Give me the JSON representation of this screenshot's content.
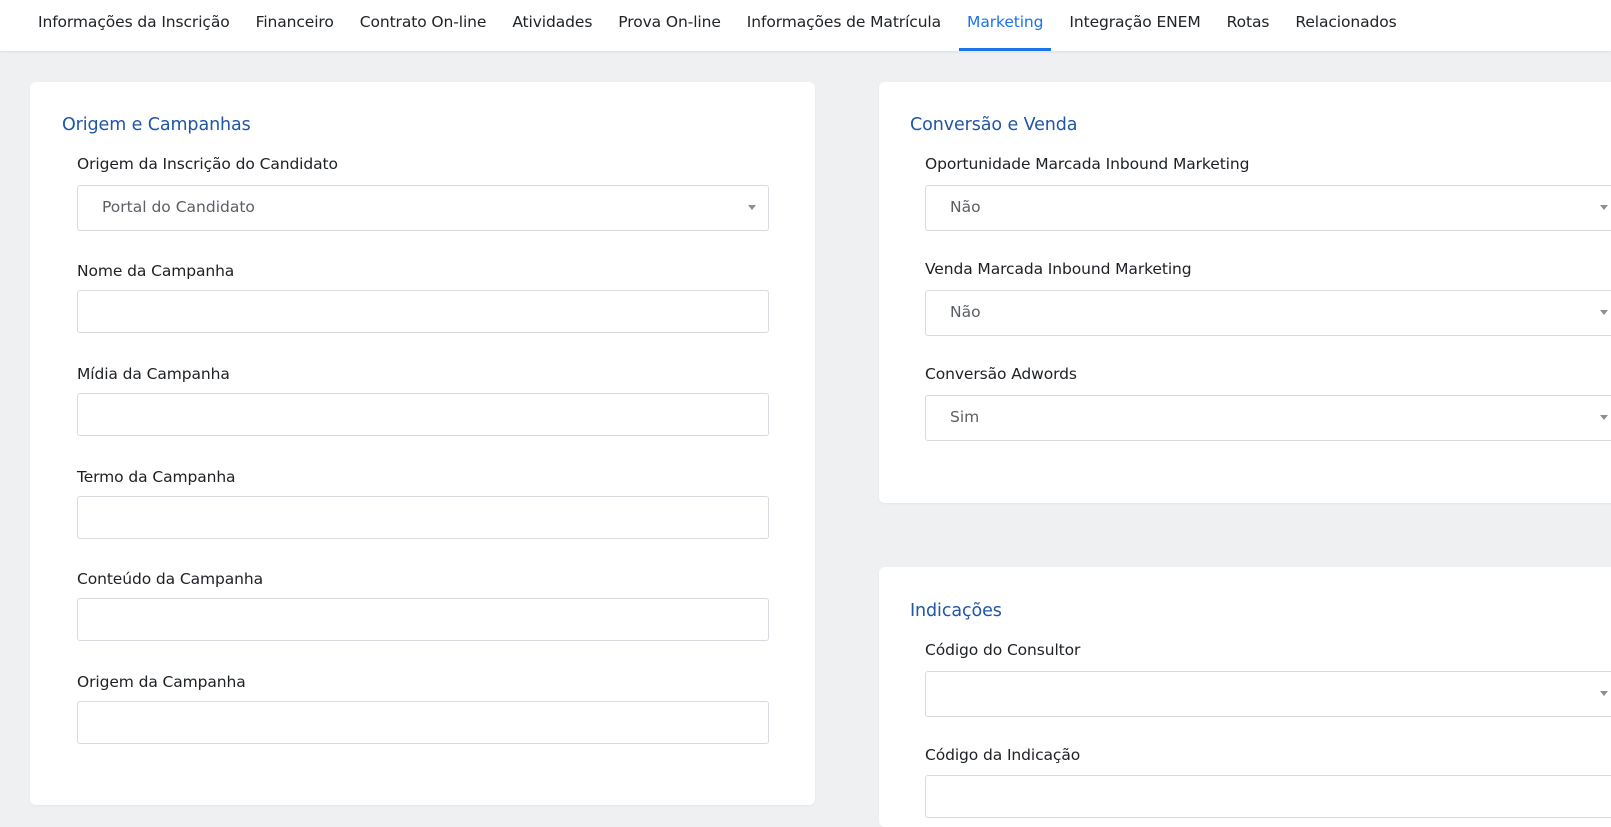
{
  "tabs": [
    {
      "label": "Informações da Inscrição",
      "active": false
    },
    {
      "label": "Financeiro",
      "active": false
    },
    {
      "label": "Contrato On-line",
      "active": false
    },
    {
      "label": "Atividades",
      "active": false
    },
    {
      "label": "Prova On-line",
      "active": false
    },
    {
      "label": "Informações de Matrícula",
      "active": false
    },
    {
      "label": "Marketing",
      "active": true
    },
    {
      "label": "Integração ENEM",
      "active": false
    },
    {
      "label": "Rotas",
      "active": false
    },
    {
      "label": "Relacionados",
      "active": false
    }
  ],
  "origem": {
    "title": "Origem e Campanhas",
    "origem_inscricao": {
      "label": "Origem da Inscrição do Candidato",
      "value": "Portal do Candidato"
    },
    "nome_campanha": {
      "label": "Nome da Campanha",
      "value": ""
    },
    "midia_campanha": {
      "label": "Mídia da Campanha",
      "value": ""
    },
    "termo_campanha": {
      "label": "Termo da Campanha",
      "value": ""
    },
    "conteudo_campanha": {
      "label": "Conteúdo da Campanha",
      "value": ""
    },
    "origem_campanha": {
      "label": "Origem da Campanha",
      "value": ""
    }
  },
  "conversao": {
    "title": "Conversão e Venda",
    "oportunidade": {
      "label": "Oportunidade Marcada Inbound Marketing",
      "value": "Não"
    },
    "venda": {
      "label": "Venda Marcada Inbound Marketing",
      "value": "Não"
    },
    "adwords": {
      "label": "Conversão Adwords",
      "value": "Sim"
    }
  },
  "indicacoes": {
    "title": "Indicações",
    "consultor": {
      "label": "Código do Consultor",
      "value": ""
    },
    "indicacao": {
      "label": "Código da Indicação",
      "value": ""
    }
  },
  "colors": {
    "accent": "#1a73e8",
    "section_title": "#1f56a6",
    "background": "#eff0f2"
  }
}
